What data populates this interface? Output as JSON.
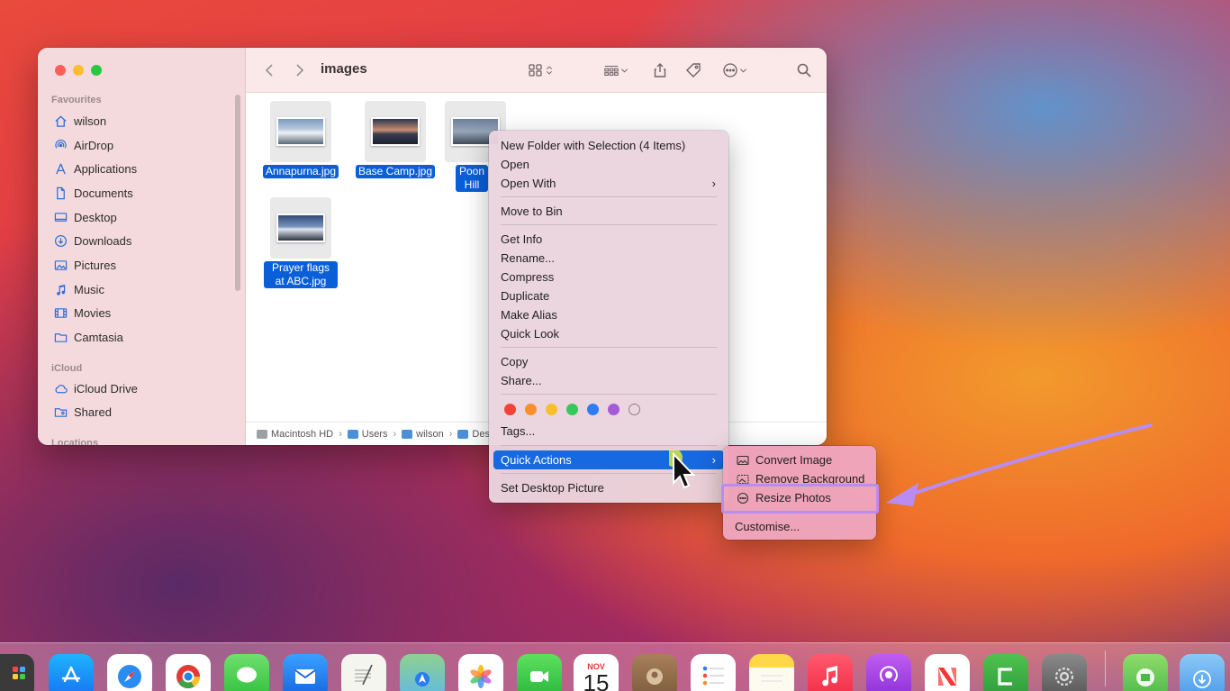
{
  "finder": {
    "title": "images",
    "sidebar": {
      "favourites_label": "Favourites",
      "favourites": [
        {
          "label": "wilson",
          "icon": "home-icon"
        },
        {
          "label": "AirDrop",
          "icon": "airdrop-icon"
        },
        {
          "label": "Applications",
          "icon": "applications-icon"
        },
        {
          "label": "Documents",
          "icon": "document-icon"
        },
        {
          "label": "Desktop",
          "icon": "desktop-icon"
        },
        {
          "label": "Downloads",
          "icon": "download-icon"
        },
        {
          "label": "Pictures",
          "icon": "pictures-icon"
        },
        {
          "label": "Music",
          "icon": "music-icon"
        },
        {
          "label": "Movies",
          "icon": "movies-icon"
        },
        {
          "label": "Camtasia",
          "icon": "folder-icon"
        }
      ],
      "icloud_label": "iCloud",
      "icloud": [
        {
          "label": "iCloud Drive",
          "icon": "cloud-icon"
        },
        {
          "label": "Shared",
          "icon": "shared-folder-icon"
        }
      ],
      "locations_label": "Locations"
    },
    "files": [
      {
        "name": "Annapurna.jpg"
      },
      {
        "name": "Base Camp.jpg"
      },
      {
        "name": "Poon Hill Station"
      },
      {
        "name": "Prayer flags at ABC.jpg"
      }
    ],
    "pathbar": [
      "Macintosh HD",
      "Users",
      "wilson",
      "Des"
    ]
  },
  "context_menu": {
    "items": {
      "new_folder": "New Folder with Selection (4 Items)",
      "open": "Open",
      "open_with": "Open With",
      "move_to_bin": "Move to Bin",
      "get_info": "Get Info",
      "rename": "Rename...",
      "compress": "Compress",
      "duplicate": "Duplicate",
      "make_alias": "Make Alias",
      "quick_look": "Quick Look",
      "copy": "Copy",
      "share": "Share...",
      "tags": "Tags...",
      "quick_actions": "Quick Actions",
      "set_desktop": "Set Desktop Picture"
    },
    "tag_colors": [
      "#f04438",
      "#f7902c",
      "#f6c02c",
      "#34c759",
      "#2f7cf6",
      "#a55bd8",
      "transparent"
    ]
  },
  "quick_actions_submenu": {
    "convert_image": "Convert Image",
    "remove_background": "Remove Background",
    "resize_photos": "Resize Photos",
    "customise": "Customise..."
  },
  "dock": {
    "calendar_month": "NOV",
    "calendar_day": "15"
  },
  "colors": {
    "selection_blue": "#0a5fd8",
    "menu_active": "#1769e0",
    "annotation_purple": "#b98cf2"
  }
}
